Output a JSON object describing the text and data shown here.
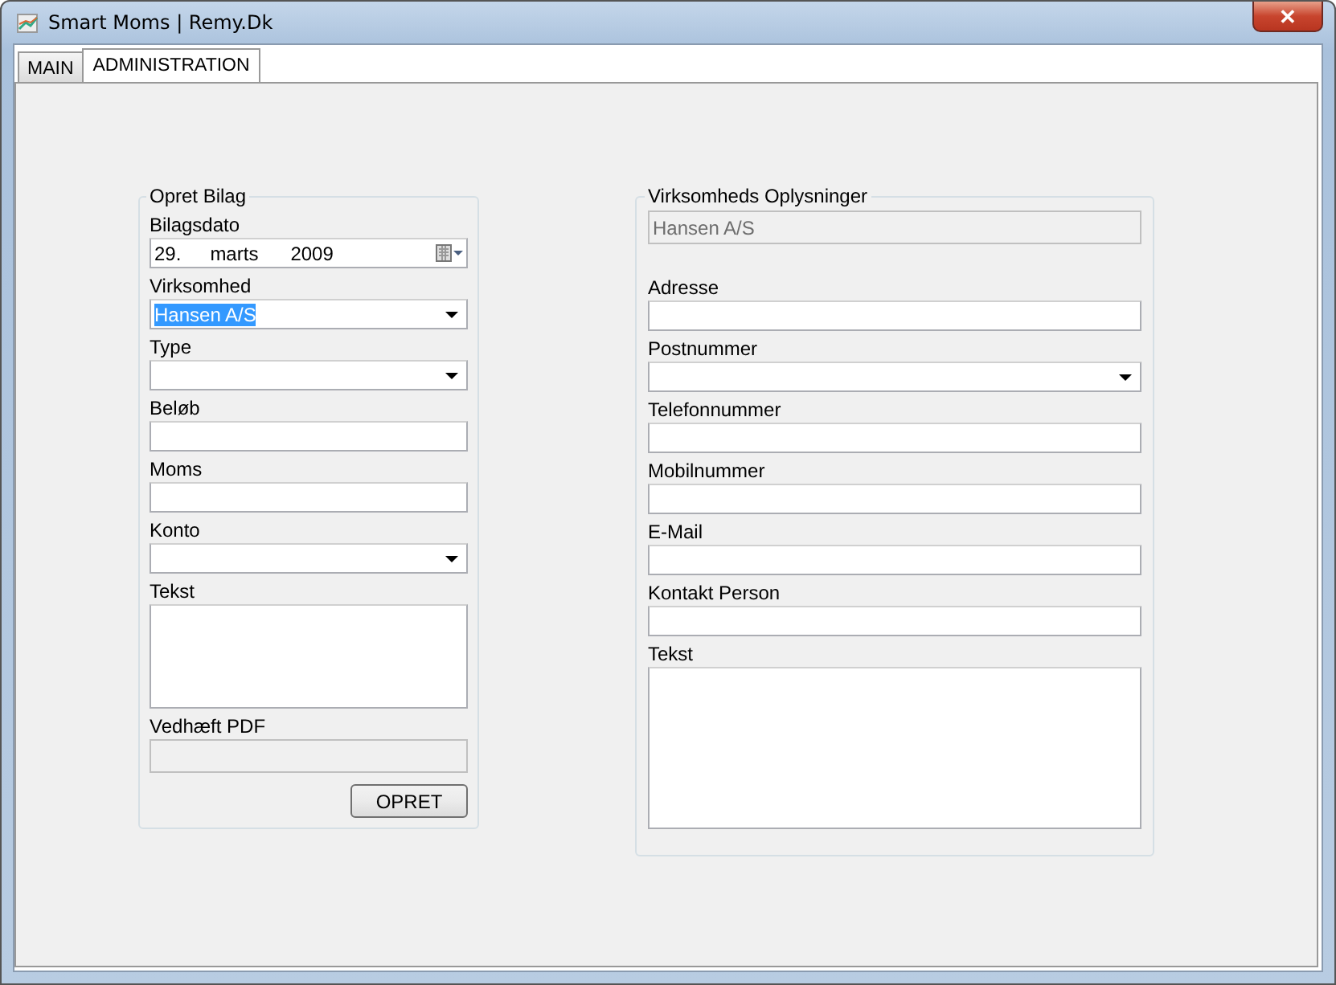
{
  "window": {
    "title": "Smart Moms  |  Remy.Dk",
    "close": "✕"
  },
  "tabs": [
    {
      "label": "MAIN",
      "selected": false
    },
    {
      "label": "ADMINISTRATION",
      "selected": true
    }
  ],
  "opret_bilag": {
    "title": "Opret Bilag",
    "fields": [
      {
        "kind": "date",
        "label": "Bilagsdato",
        "day": "29.",
        "month": "marts",
        "year": "2009"
      },
      {
        "kind": "combo",
        "label": "Virksomhed",
        "value": "Hansen A/S",
        "highlighted": true
      },
      {
        "kind": "combo",
        "label": "Type"
      },
      {
        "kind": "text",
        "label": "Beløb"
      },
      {
        "kind": "text",
        "label": "Moms"
      },
      {
        "kind": "combo",
        "label": "Konto"
      },
      {
        "kind": "textarea",
        "label": "Tekst"
      },
      {
        "kind": "disabled",
        "label": "Vedhæft PDF"
      }
    ],
    "button": "OPRET"
  },
  "virksomheds_oplysninger": {
    "title": "Virksomheds Oplysninger",
    "fields": [
      {
        "kind": "disabled",
        "value": "Hansen A/S"
      },
      {
        "kind": "text",
        "label": "Adresse"
      },
      {
        "kind": "combo",
        "label": "Postnummer"
      },
      {
        "kind": "text",
        "label": "Telefonnummer"
      },
      {
        "kind": "text",
        "label": "Mobilnummer"
      },
      {
        "kind": "text",
        "label": "E-Mail"
      },
      {
        "kind": "text",
        "label": "Kontakt Person"
      },
      {
        "kind": "textarea",
        "label": "Tekst"
      }
    ]
  }
}
